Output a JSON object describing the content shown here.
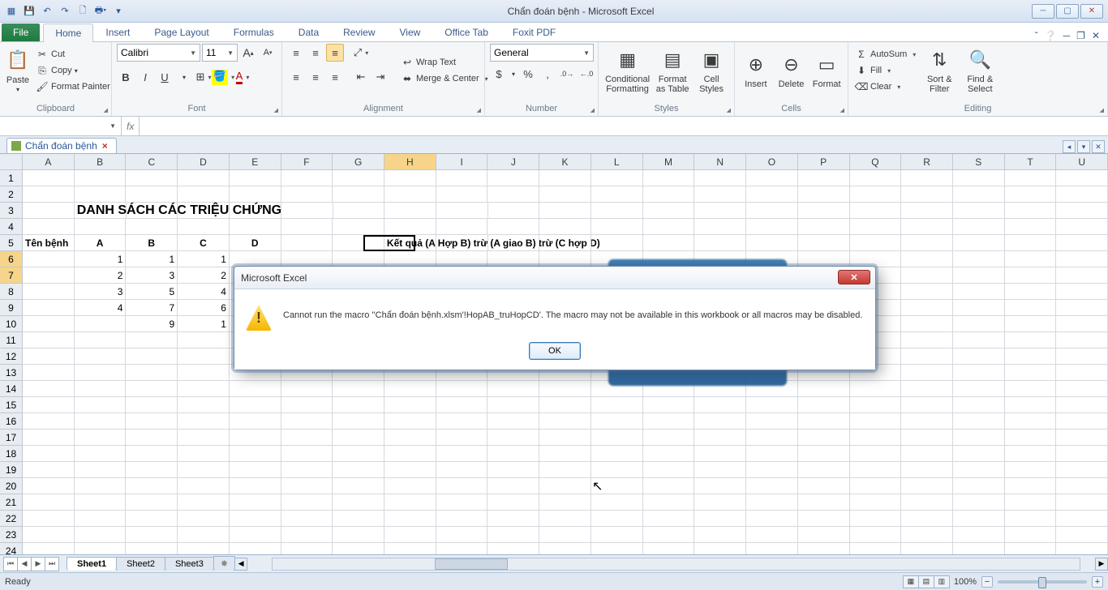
{
  "app": {
    "title": "Chẩn đoán bệnh - Microsoft Excel"
  },
  "qat": {
    "save": "💾",
    "undo": "↶",
    "redo": "↷",
    "new": "▥",
    "print": "⎙"
  },
  "win": {
    "min": "─",
    "max": "▢",
    "close": "✕"
  },
  "tabs": {
    "file": "File",
    "home": "Home",
    "insert": "Insert",
    "pagelayout": "Page Layout",
    "formulas": "Formulas",
    "data": "Data",
    "review": "Review",
    "view": "View",
    "officetab": "Office Tab",
    "foxit": "Foxit PDF"
  },
  "ribbon": {
    "clipboard": {
      "label": "Clipboard",
      "paste": "Paste",
      "cut": "Cut",
      "copy": "Copy",
      "painter": "Format Painter"
    },
    "font": {
      "label": "Font",
      "name": "Calibri",
      "size": "11",
      "bold": "B",
      "italic": "I",
      "underline": "U",
      "growA": "A",
      "shrinkA": "A"
    },
    "alignment": {
      "label": "Alignment",
      "wrap": "Wrap Text",
      "merge": "Merge & Center"
    },
    "number": {
      "label": "Number",
      "format": "General",
      "currency": "$",
      "percent": "%",
      "comma": ",",
      "inc": ".0 →.00",
      "dec": ".00→.0"
    },
    "styles": {
      "label": "Styles",
      "cond": "Conditional Formatting",
      "table": "Format as Table",
      "cell": "Cell Styles"
    },
    "cells": {
      "label": "Cells",
      "insert": "Insert",
      "delete": "Delete",
      "format": "Format"
    },
    "editing": {
      "label": "Editing",
      "autosum": "AutoSum",
      "fill": "Fill",
      "clear": "Clear",
      "sort": "Sort & Filter",
      "find": "Find & Select"
    }
  },
  "namebox": "",
  "workbook_tab": "Chẩn đoán bệnh",
  "columns": [
    "A",
    "B",
    "C",
    "D",
    "E",
    "F",
    "G",
    "H",
    "I",
    "J",
    "K",
    "L",
    "M",
    "N",
    "O",
    "P",
    "Q",
    "R",
    "S",
    "T",
    "U"
  ],
  "active_col": "H",
  "active_rows": [
    6,
    7
  ],
  "selected_cell": "H6",
  "sheet": {
    "title_row": 3,
    "title_col": "B",
    "title": "DANH SÁCH CÁC TRIỆU CHỨNG",
    "header_row": 5,
    "headers": {
      "A": "Tên bệnh",
      "B": "A",
      "C": "B",
      "D": "C",
      "E": "D",
      "H": "Kết quả (A Hợp B) trừ (A giao B) trừ (C hợp D)"
    },
    "data": {
      "6": {
        "B": "1",
        "C": "1",
        "D": "1"
      },
      "7": {
        "B": "2",
        "C": "3",
        "D": "2"
      },
      "8": {
        "B": "3",
        "C": "5",
        "D": "4"
      },
      "9": {
        "B": "4",
        "C": "7",
        "D": "6"
      },
      "10": {
        "C": "9",
        "D": "1"
      }
    }
  },
  "dialog": {
    "title": "Microsoft Excel",
    "message": "Cannot run the macro ''Chẩn đoán bệnh.xlsm'!HopAB_truHopCD'. The macro may not be available in this workbook or all macros may be disabled.",
    "ok": "OK"
  },
  "sheets": {
    "s1": "Sheet1",
    "s2": "Sheet2",
    "s3": "Sheet3"
  },
  "status": {
    "ready": "Ready",
    "zoom": "100%"
  }
}
